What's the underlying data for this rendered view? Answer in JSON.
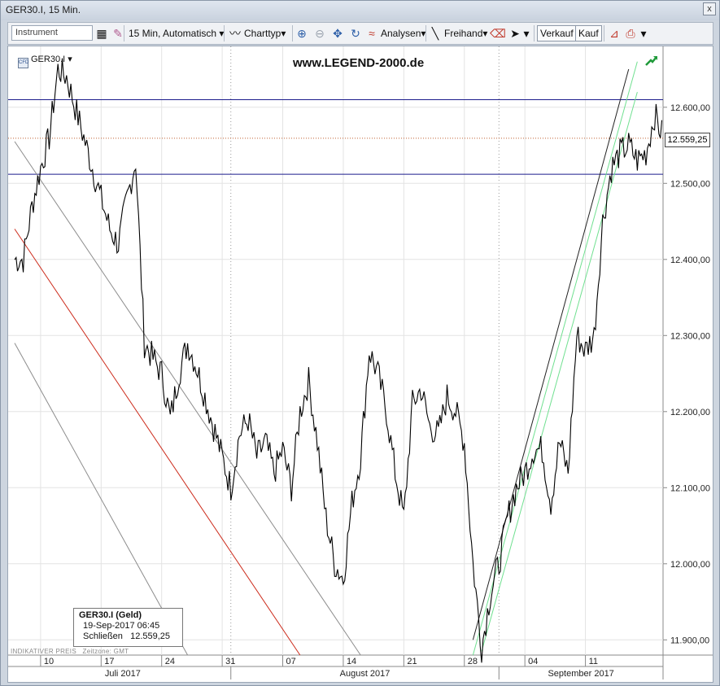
{
  "window": {
    "title": "GER30.I, 15 Min.",
    "close_label": "x"
  },
  "toolbar": {
    "instrument_placeholder": "Instrument",
    "timeframe": "15 Min,",
    "mode": "Automatisch",
    "charttyp": "Charttyp",
    "analysen": "Analysen",
    "freihand": "Freihand",
    "verkauf": "Verkauf",
    "kauf": "Kauf"
  },
  "chart_header": {
    "instrument": "GER30.I",
    "watermark": "www.LEGEND-2000.de"
  },
  "tooltip": {
    "title": "GER30.I (Geld)",
    "datetime": "19-Sep-2017 06:45",
    "close_label": "Schließen",
    "close_value": "12.559,25"
  },
  "footer": {
    "indicator": "INDIKATIVER PREIS",
    "timezone": "Zeitzone: GMT"
  },
  "last_price_label": "12.559,25",
  "colors": {
    "candles": "#000000",
    "resistance": "#1c1c8c",
    "support": "#1c1c8c",
    "last_line": "#c06030",
    "downtrend_red": "#cc2a1a",
    "channel_gray": "#8c8c8c",
    "channel_green": "#70e090",
    "uptrend_dark": "#222222"
  },
  "chart_data": {
    "type": "line",
    "title": "",
    "ylim": [
      11880,
      12680
    ],
    "yticks": [
      11900,
      12000,
      12100,
      12200,
      12300,
      12400,
      12500,
      12600
    ],
    "ytick_labels": [
      "11.900,00",
      "12.000,00",
      "12.100,00",
      "12.200,00",
      "12.300,00",
      "12.400,00",
      "12.500,00",
      "12.600,00"
    ],
    "xtick_labels": [
      "10",
      "17",
      "24",
      "31",
      "07",
      "14",
      "21",
      "28",
      "04",
      "11"
    ],
    "month_labels": [
      "Juli 2017",
      "August 2017",
      "September 2017"
    ],
    "horizontal_levels": [
      12610,
      12512,
      12559.25
    ],
    "x_dates": [
      "2017-07-07",
      "2017-07-08",
      "2017-07-09",
      "2017-07-10",
      "2017-07-11",
      "2017-07-12",
      "2017-07-13",
      "2017-07-14",
      "2017-07-15",
      "2017-07-16",
      "2017-07-17",
      "2017-07-18",
      "2017-07-19",
      "2017-07-20",
      "2017-07-21",
      "2017-07-22",
      "2017-07-23",
      "2017-07-24",
      "2017-07-25",
      "2017-07-26",
      "2017-07-27",
      "2017-07-28",
      "2017-07-29",
      "2017-07-30",
      "2017-07-31",
      "2017-08-01",
      "2017-08-02",
      "2017-08-03",
      "2017-08-04",
      "2017-08-05",
      "2017-08-06",
      "2017-08-07",
      "2017-08-08",
      "2017-08-09",
      "2017-08-10",
      "2017-08-11",
      "2017-08-12",
      "2017-08-13",
      "2017-08-14",
      "2017-08-15",
      "2017-08-16",
      "2017-08-17",
      "2017-08-18",
      "2017-08-19",
      "2017-08-20",
      "2017-08-21",
      "2017-08-22",
      "2017-08-23",
      "2017-08-24",
      "2017-08-25",
      "2017-08-26",
      "2017-08-27",
      "2017-08-28",
      "2017-08-29",
      "2017-08-30",
      "2017-08-31",
      "2017-09-01",
      "2017-09-02",
      "2017-09-03",
      "2017-09-04",
      "2017-09-05",
      "2017-09-06",
      "2017-09-07",
      "2017-09-08",
      "2017-09-09",
      "2017-09-10",
      "2017-09-11",
      "2017-09-12",
      "2017-09-13",
      "2017-09-14",
      "2017-09-15",
      "2017-09-16",
      "2017-09-17",
      "2017-09-18",
      "2017-09-19"
    ],
    "series": [
      {
        "values": [
          12400,
          12470,
          12520,
          12560,
          12650,
          12640,
          12600,
          12560,
          12520,
          12480,
          12440,
          12420,
          12480,
          12530,
          12290,
          12270,
          12250,
          12190,
          12250,
          12290,
          12260,
          12220,
          12180,
          12140,
          12100,
          12170,
          12190,
          12140,
          12160,
          12120,
          12150,
          12100,
          12200,
          12240,
          12160,
          12060,
          12000,
          11980,
          12080,
          12140,
          12280,
          12250,
          12200,
          12120,
          12060,
          12210,
          12230,
          12180,
          12170,
          12220,
          12200,
          12160,
          12000,
          11890,
          11960,
          12000,
          12060,
          12100,
          12120,
          12150,
          12150,
          12080,
          12160,
          12120,
          12300,
          12280,
          12300,
          12450,
          12520,
          12540,
          12550,
          12530,
          12540,
          12590,
          12560
        ]
      }
    ]
  }
}
